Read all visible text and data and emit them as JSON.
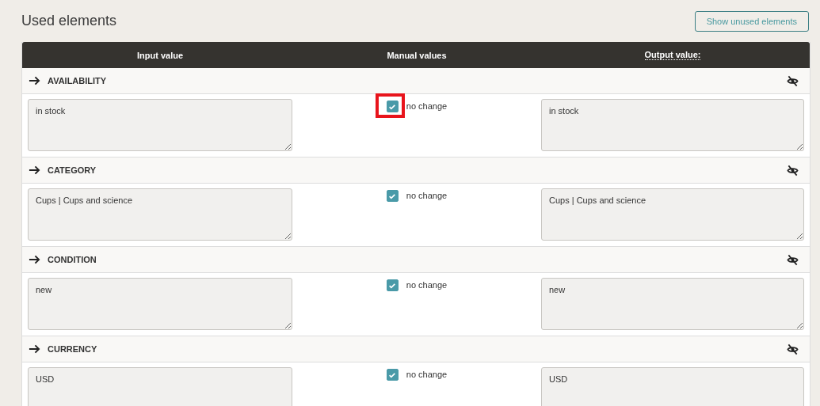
{
  "title": "Used elements",
  "show_unused_button": "Show unused elements",
  "columns": [
    "Input value",
    "Manual values",
    "Output value:"
  ],
  "elements": [
    {
      "name": "AVAILABILITY",
      "input": "in stock",
      "manual_label": "no change",
      "checked": true,
      "highlighted": true,
      "output": "in stock"
    },
    {
      "name": "CATEGORY",
      "input": "Cups | Cups and science",
      "manual_label": "no change",
      "checked": true,
      "highlighted": false,
      "output": "Cups | Cups and science"
    },
    {
      "name": "CONDITION",
      "input": "new",
      "manual_label": "no change",
      "checked": true,
      "highlighted": false,
      "output": "new"
    },
    {
      "name": "CURRENCY",
      "input": "USD",
      "manual_label": "no change",
      "checked": true,
      "highlighted": false,
      "output": "USD"
    }
  ]
}
